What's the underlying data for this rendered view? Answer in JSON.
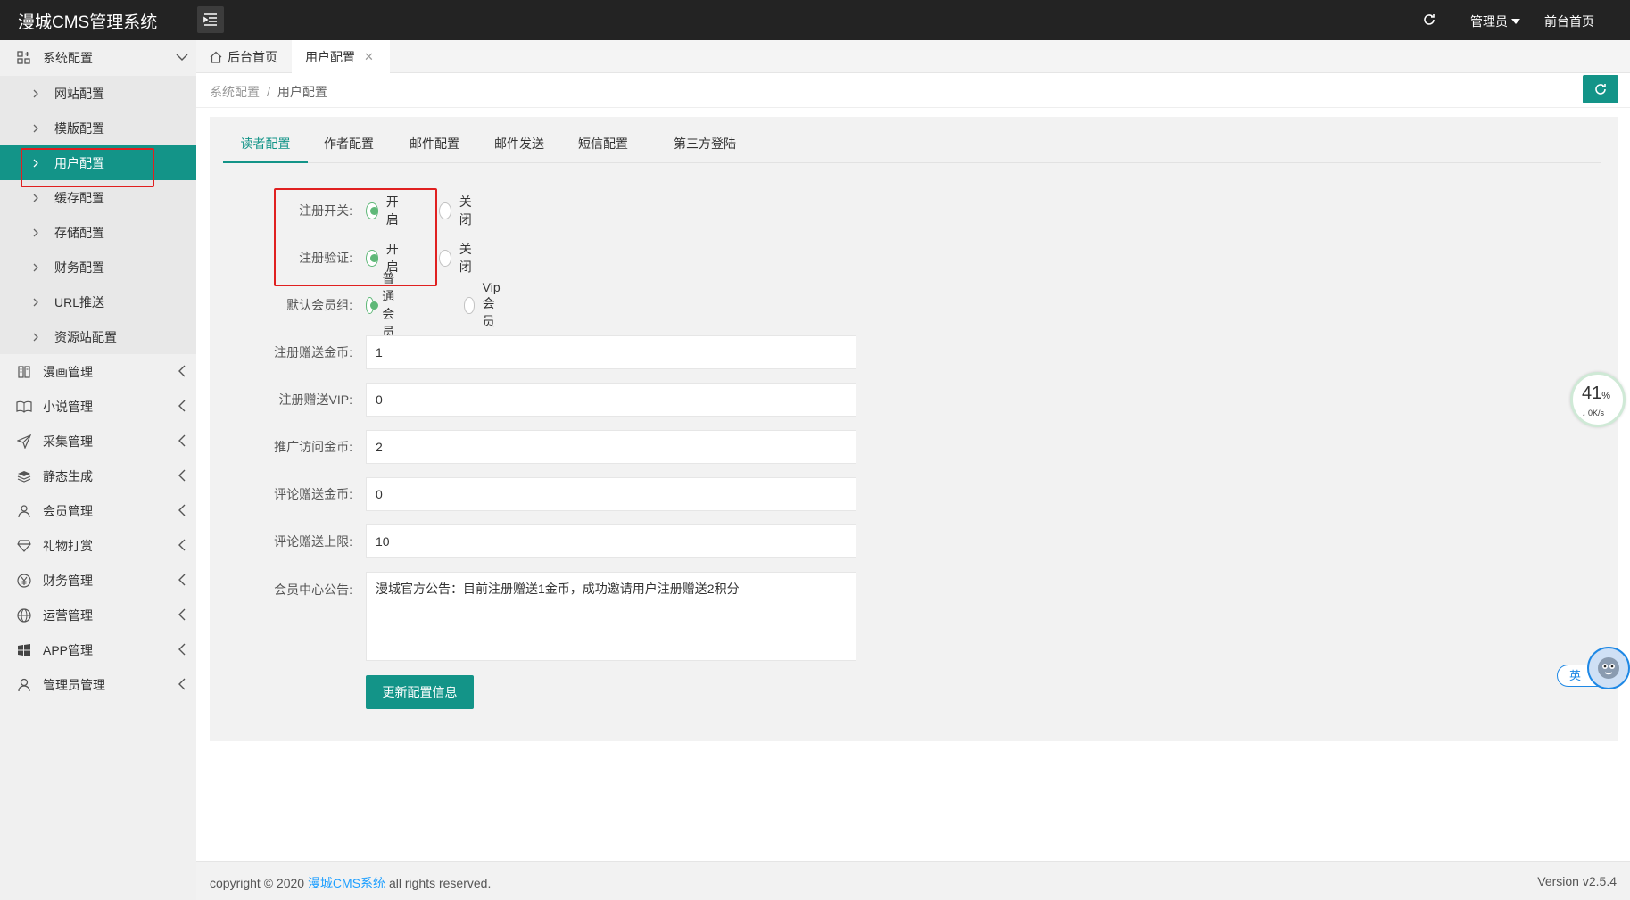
{
  "header": {
    "logo": "漫城CMS管理系统",
    "admin_label": "管理员",
    "front_label": "前台首页"
  },
  "sidebar": {
    "groups": [
      {
        "label": "系统配置",
        "icon": "grid-icon"
      },
      {
        "label": "漫画管理",
        "icon": "book-icon"
      },
      {
        "label": "小说管理",
        "icon": "open-book-icon"
      },
      {
        "label": "采集管理",
        "icon": "send-icon"
      },
      {
        "label": "静态生成",
        "icon": "layers-icon"
      },
      {
        "label": "会员管理",
        "icon": "users-icon"
      },
      {
        "label": "礼物打赏",
        "icon": "diamond-icon"
      },
      {
        "label": "财务管理",
        "icon": "yen-icon"
      },
      {
        "label": "运营管理",
        "icon": "globe-icon"
      },
      {
        "label": "APP管理",
        "icon": "windows-icon"
      },
      {
        "label": "管理员管理",
        "icon": "user-icon"
      }
    ],
    "sub_items": [
      "网站配置",
      "模版配置",
      "用户配置",
      "缓存配置",
      "存储配置",
      "财务配置",
      "URL推送",
      "资源站配置"
    ]
  },
  "tabs": {
    "home": "后台首页",
    "current": "用户配置"
  },
  "breadcrumb": {
    "parent": "系统配置",
    "sep": "/",
    "current": "用户配置"
  },
  "inner_tabs": [
    "读者配置",
    "作者配置",
    "邮件配置",
    "邮件发送",
    "短信配置",
    "第三方登陆"
  ],
  "form": {
    "reg_switch": {
      "label": "注册开关:",
      "on": "开启",
      "off": "关闭",
      "value": "开启"
    },
    "reg_verify": {
      "label": "注册验证:",
      "on": "开启",
      "off": "关闭",
      "value": "开启"
    },
    "member_group": {
      "label": "默认会员组:",
      "opt1": "普通会员",
      "opt2": "Vip会员",
      "value": "普通会员"
    },
    "reg_coins": {
      "label": "注册赠送金币:",
      "value": "1"
    },
    "reg_vip": {
      "label": "注册赠送VIP:",
      "value": "0"
    },
    "promo_coins": {
      "label": "推广访问金币:",
      "value": "2"
    },
    "comment_coins": {
      "label": "评论赠送金币:",
      "value": "0"
    },
    "comment_limit": {
      "label": "评论赠送上限:",
      "value": "10"
    },
    "notice": {
      "label": "会员中心公告:",
      "value": "漫城官方公告：目前注册赠送1金币，成功邀请用户注册赠送2积分"
    },
    "submit": "更新配置信息"
  },
  "footer": {
    "copy_prefix": "copyright © 2020 ",
    "brand": "漫城CMS系统",
    "copy_suffix": " all rights reserved.",
    "version": "Version v2.5.4"
  },
  "widgets": {
    "speed_percent": "41",
    "speed_unit": "%",
    "speed_rate": "↓ 0K/s",
    "lang": "英"
  },
  "colors": {
    "accent": "#139488",
    "header_bg": "#232323",
    "radio_on": "#5fb878",
    "highlight": "#e02020"
  }
}
